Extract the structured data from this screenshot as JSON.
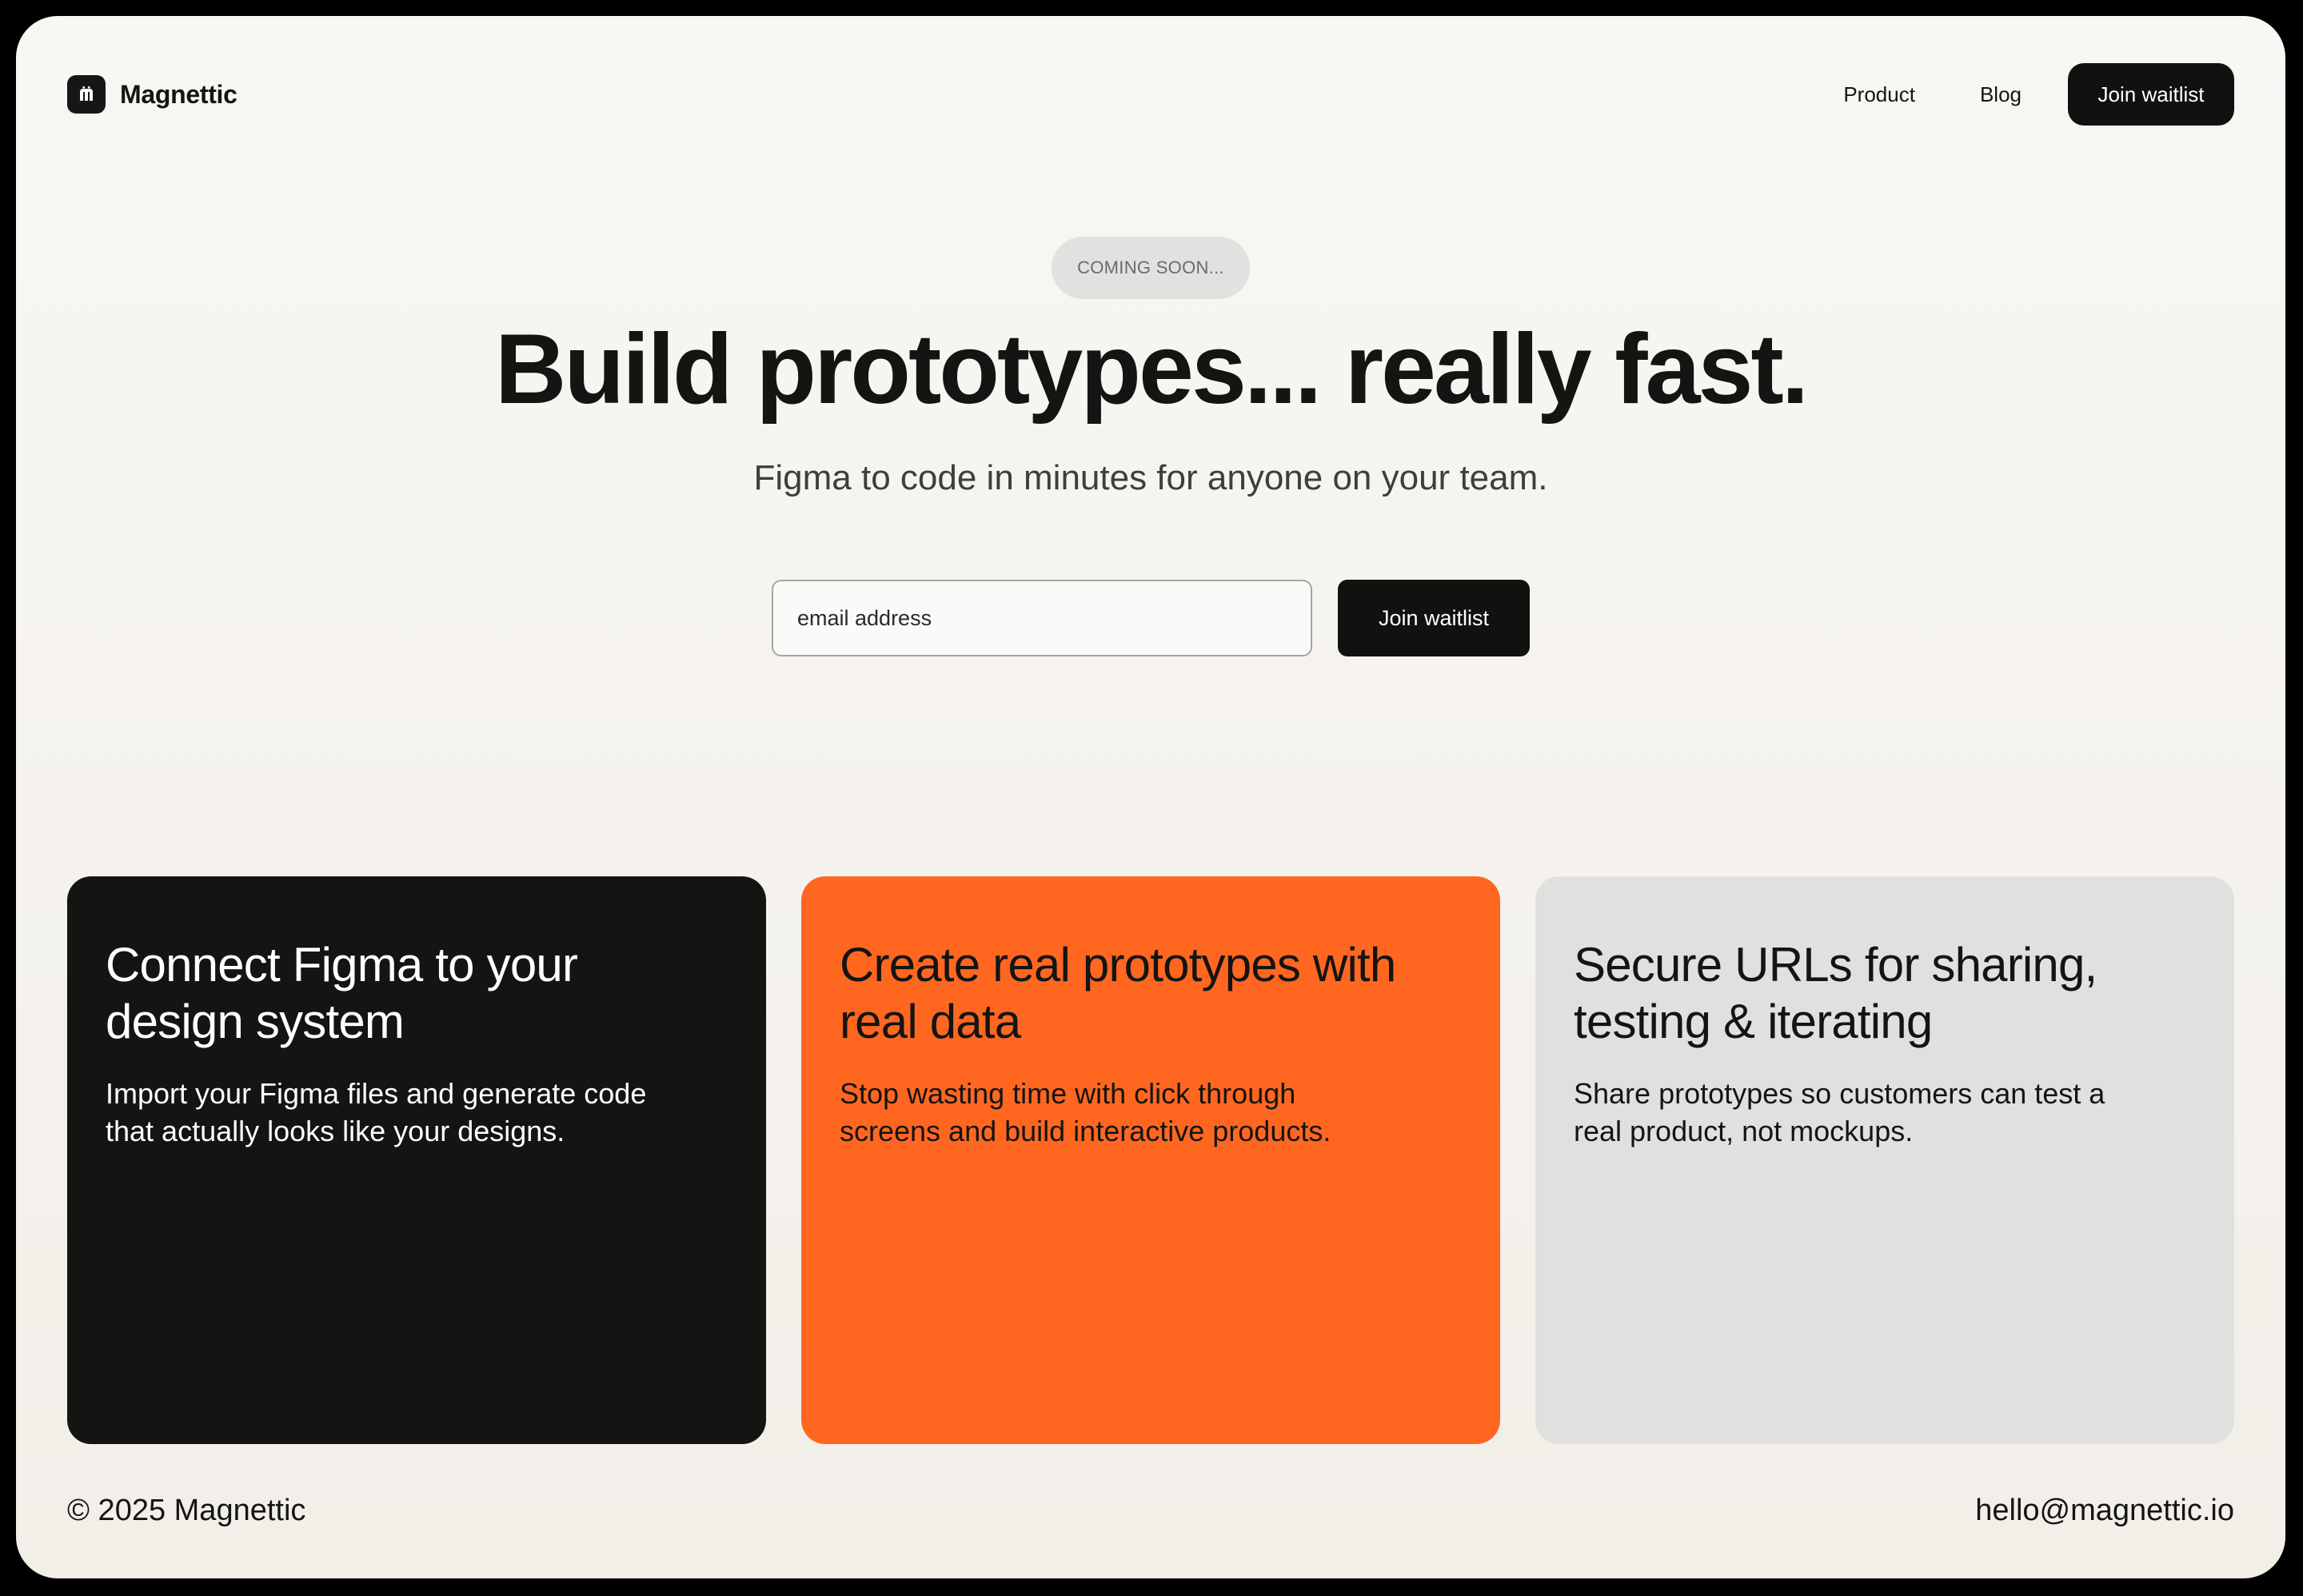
{
  "brand": {
    "name": "Magnettic",
    "logo_icon": "magnet-m-logo-icon"
  },
  "nav": {
    "product_label": "Product",
    "blog_label": "Blog",
    "cta_label": "Join waitlist"
  },
  "hero": {
    "badge": "COMING SOON...",
    "headline": "Build prototypes... really fast.",
    "subheadline": "Figma to code in minutes for anyone on your team.",
    "email_placeholder": "email address",
    "email_value": "",
    "submit_label": "Join waitlist"
  },
  "features": [
    {
      "title": "Connect Figma to your design system",
      "body": "Import your Figma files and generate code that actually looks like your designs."
    },
    {
      "title": "Create real prototypes with real data",
      "body": "Stop wasting time with click through screens and build interactive products."
    },
    {
      "title": "Secure URLs for sharing, testing & iterating",
      "body": "Share prototypes so customers can test a real product, not mockups."
    }
  ],
  "footer": {
    "copyright": "© 2025 Magnettic",
    "email": "hello@magnettic.io"
  },
  "colors": {
    "background": "#f8f7f4",
    "dark": "#141412",
    "accent_orange": "#ff6721",
    "grey_card": "#e0e0de",
    "badge_bg": "#e2e1df"
  }
}
